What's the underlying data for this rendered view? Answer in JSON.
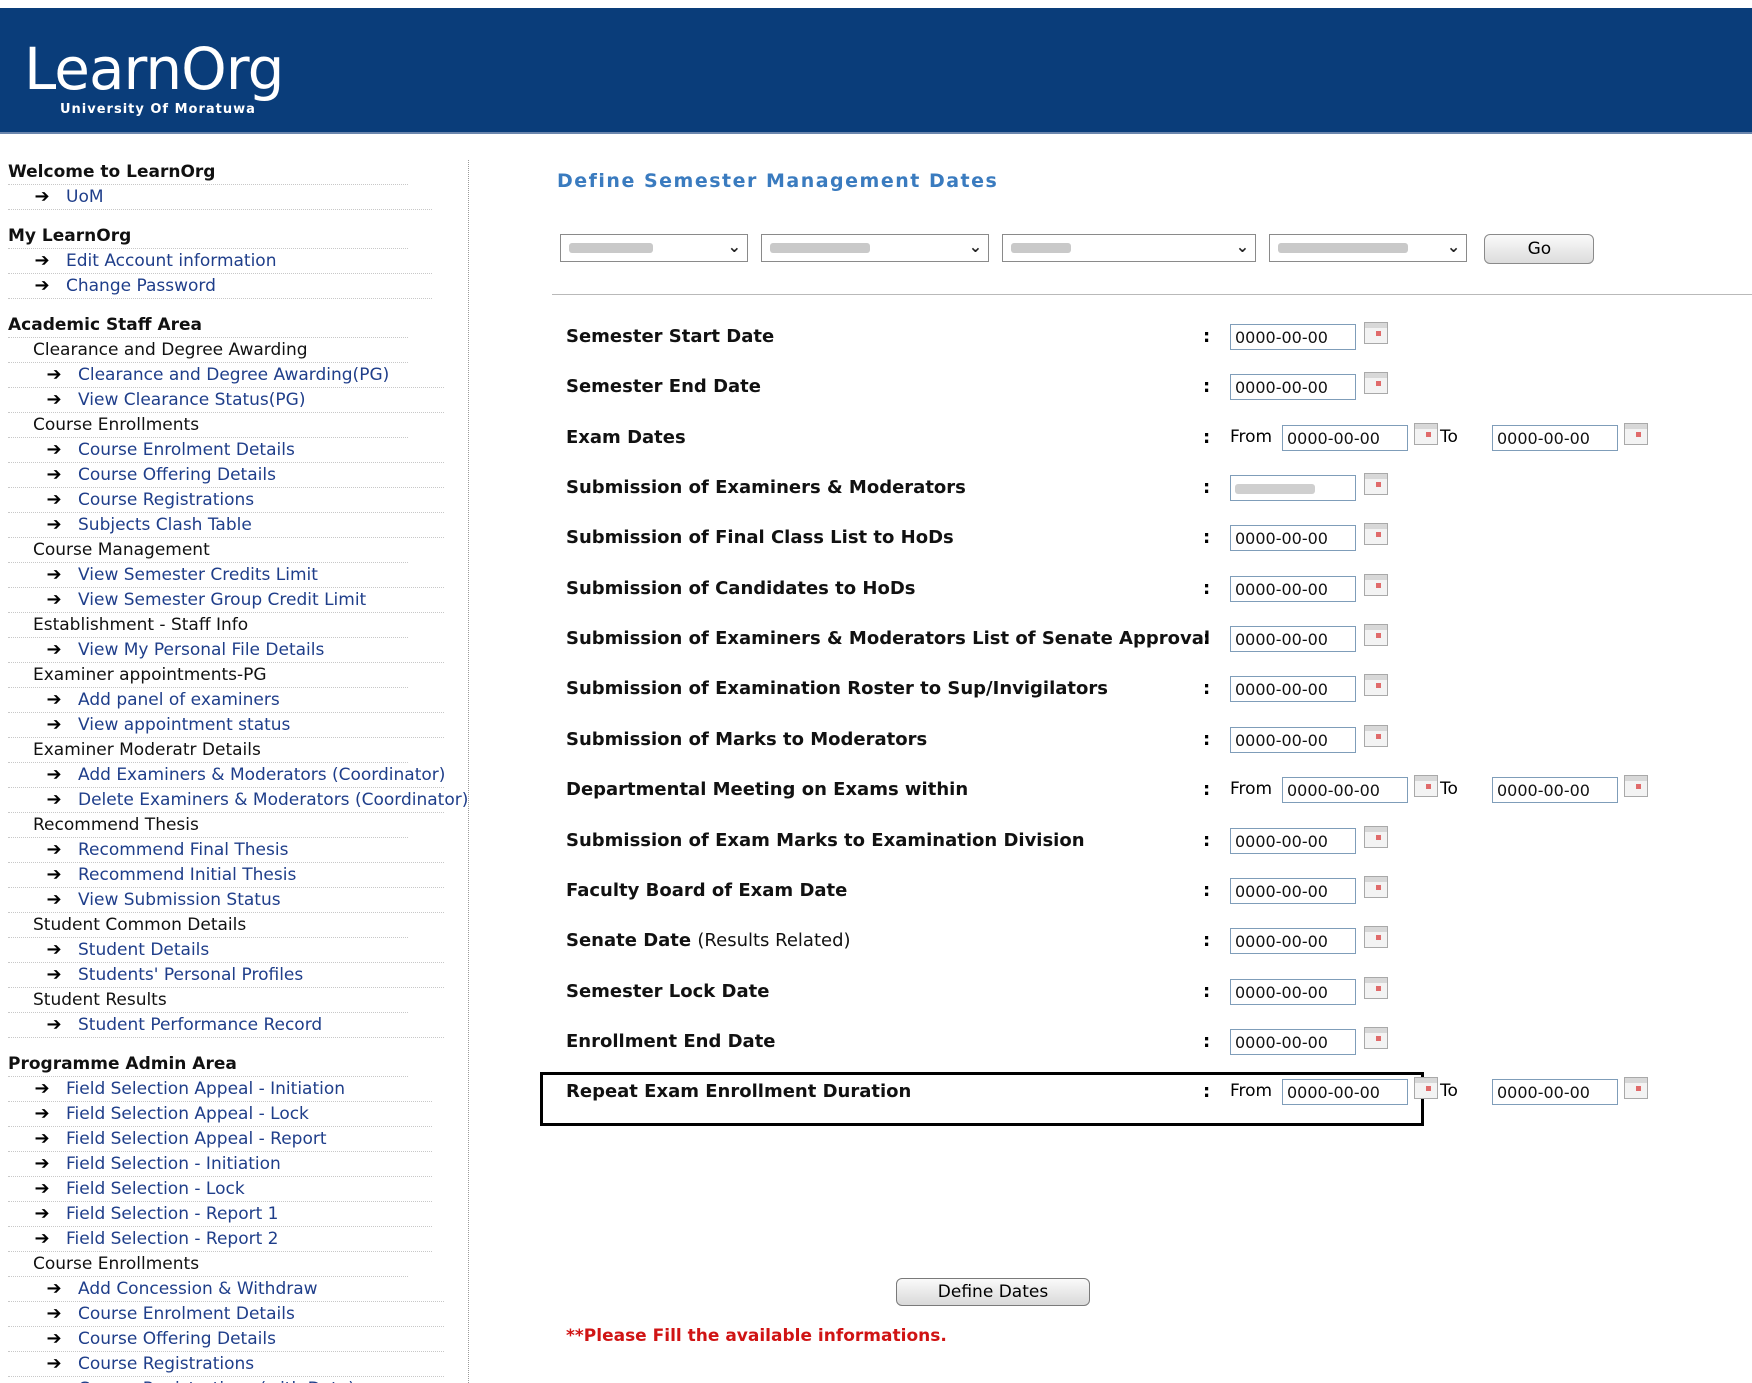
{
  "header": {
    "logo_text": "LearnOrg",
    "logo_subtitle": "University Of Moratuwa"
  },
  "sidebar": {
    "sections": [
      {
        "title": "Welcome to LearnOrg",
        "items": [
          {
            "type": "link",
            "label": "UoM"
          }
        ]
      },
      {
        "title": "My LearnOrg",
        "items": [
          {
            "type": "link",
            "label": "Edit Account information"
          },
          {
            "type": "link",
            "label": "Change Password"
          }
        ]
      },
      {
        "title": "Academic Staff Area",
        "items": [
          {
            "type": "group",
            "label": "Clearance and Degree Awarding"
          },
          {
            "type": "sublink",
            "label": "Clearance and Degree Awarding(PG)"
          },
          {
            "type": "sublink",
            "label": "View Clearance Status(PG)"
          },
          {
            "type": "group",
            "label": "Course Enrollments"
          },
          {
            "type": "sublink",
            "label": "Course Enrolment Details"
          },
          {
            "type": "sublink",
            "label": "Course Offering Details"
          },
          {
            "type": "sublink",
            "label": "Course Registrations"
          },
          {
            "type": "sublink",
            "label": "Subjects Clash Table"
          },
          {
            "type": "group",
            "label": "Course Management"
          },
          {
            "type": "sublink",
            "label": "View Semester Credits Limit"
          },
          {
            "type": "sublink",
            "label": "View Semester Group Credit Limit"
          },
          {
            "type": "group",
            "label": "Establishment - Staff Info"
          },
          {
            "type": "sublink",
            "label": "View My Personal File Details"
          },
          {
            "type": "group",
            "label": "Examiner appointments-PG"
          },
          {
            "type": "sublink",
            "label": "Add panel of examiners"
          },
          {
            "type": "sublink",
            "label": "View appointment status"
          },
          {
            "type": "group",
            "label": "Examiner Moderatr Details"
          },
          {
            "type": "sublink",
            "label": "Add Examiners & Moderators (Coordinator)"
          },
          {
            "type": "sublink",
            "label": "Delete Examiners & Moderators (Coordinator)"
          },
          {
            "type": "group",
            "label": "Recommend Thesis"
          },
          {
            "type": "sublink",
            "label": "Recommend Final Thesis"
          },
          {
            "type": "sublink",
            "label": "Recommend Initial Thesis"
          },
          {
            "type": "sublink",
            "label": "View Submission Status"
          },
          {
            "type": "group",
            "label": "Student Common Details"
          },
          {
            "type": "sublink",
            "label": "Student Details"
          },
          {
            "type": "sublink",
            "label": "Students' Personal Profiles"
          },
          {
            "type": "group",
            "label": "Student Results"
          },
          {
            "type": "sublink",
            "label": "Student Performance Record"
          }
        ]
      },
      {
        "title": "Programme Admin Area",
        "items": [
          {
            "type": "link",
            "label": "Field Selection Appeal - Initiation"
          },
          {
            "type": "link",
            "label": "Field Selection Appeal - Lock"
          },
          {
            "type": "link",
            "label": "Field Selection Appeal - Report"
          },
          {
            "type": "link",
            "label": "Field Selection - Initiation"
          },
          {
            "type": "link",
            "label": "Field Selection - Lock"
          },
          {
            "type": "link",
            "label": "Field Selection - Report 1"
          },
          {
            "type": "link",
            "label": "Field Selection - Report 2"
          },
          {
            "type": "group",
            "label": "Course Enrollments"
          },
          {
            "type": "sublink",
            "label": "Add Concession & Withdraw"
          },
          {
            "type": "sublink",
            "label": "Course Enrolment Details"
          },
          {
            "type": "sublink",
            "label": "Course Offering Details"
          },
          {
            "type": "sublink",
            "label": "Course Registrations"
          },
          {
            "type": "sublink",
            "label": "Course Registrations (with Date)"
          }
        ]
      }
    ]
  },
  "main": {
    "title": "Define Semester Management Dates",
    "selectors": {
      "go_label": "Go"
    },
    "colon": ":",
    "from_label": "From",
    "to_label": "To",
    "rows": [
      {
        "label": "Semester Start Date",
        "kind": "single",
        "value": "0000-00-00"
      },
      {
        "label": "Semester End Date",
        "kind": "single",
        "value": "0000-00-00"
      },
      {
        "label": "Exam Dates",
        "kind": "range",
        "from": "0000-00-00",
        "to": "0000-00-00"
      },
      {
        "label": "Submission of Examiners & Moderators",
        "kind": "single",
        "value": "",
        "blurred": true
      },
      {
        "label": "Submission of Final Class List to HoDs",
        "kind": "single",
        "value": "0000-00-00"
      },
      {
        "label": "Submission of Candidates to HoDs",
        "kind": "single",
        "value": "0000-00-00"
      },
      {
        "label": "Submission of Examiners & Moderators List of Senate Approval",
        "kind": "single",
        "value": "0000-00-00"
      },
      {
        "label": "Submission of Examination Roster to Sup/Invigilators",
        "kind": "single",
        "value": "0000-00-00"
      },
      {
        "label": "Submission of Marks to Moderators",
        "kind": "single",
        "value": "0000-00-00"
      },
      {
        "label": "Departmental Meeting on Exams within",
        "kind": "range",
        "from": "0000-00-00",
        "to": "0000-00-00"
      },
      {
        "label": "Submission of Exam Marks to Examination Division",
        "kind": "single",
        "value": "0000-00-00"
      },
      {
        "label": "Faculty Board of Exam Date",
        "kind": "single",
        "value": "0000-00-00"
      },
      {
        "label": "Senate Date",
        "note": "(Results Related)",
        "kind": "single",
        "value": "0000-00-00"
      },
      {
        "label": "Semester Lock Date",
        "kind": "single",
        "value": "0000-00-00",
        "highlighted": true
      },
      {
        "label": "Enrollment End Date",
        "kind": "single",
        "value": "0000-00-00"
      },
      {
        "label": "Repeat Exam Enrollment Duration",
        "kind": "range",
        "from": "0000-00-00",
        "to": "0000-00-00"
      }
    ],
    "define_button": "Define Dates",
    "warning": "**Please Fill the available informations."
  },
  "icons": {
    "nav_arrow": "arrow-right-icon",
    "calendar": "calendar-icon"
  }
}
